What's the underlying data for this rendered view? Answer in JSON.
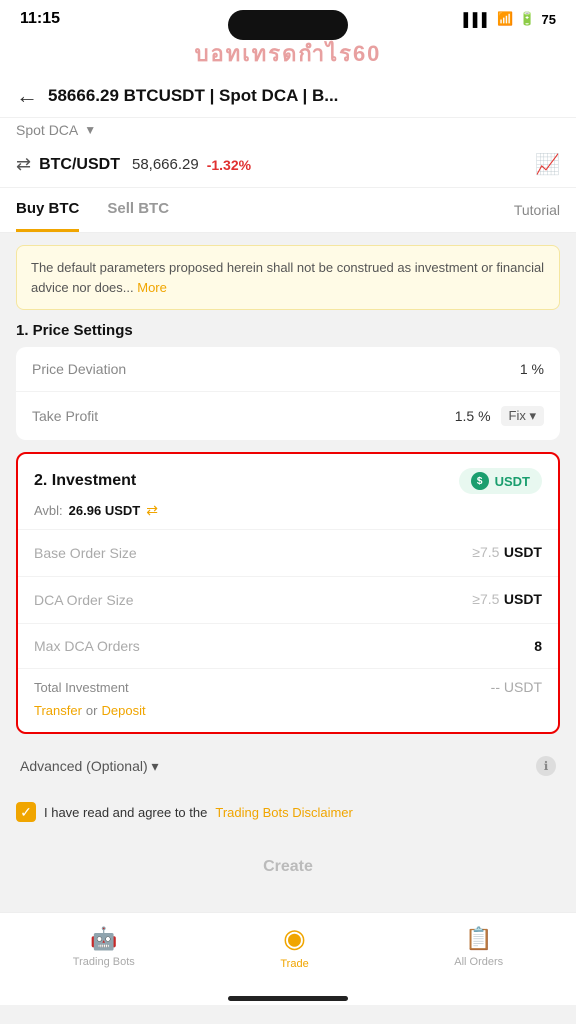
{
  "statusBar": {
    "time": "11:15",
    "batteryLevel": "75"
  },
  "header": {
    "title": "58666.29 BTCUSDT | Spot DCA | B...",
    "backLabel": "←"
  },
  "subHeader": {
    "label": "Spot DCA",
    "dropdownArrow": "▼"
  },
  "pairRow": {
    "swapIcon": "⇄",
    "pairName": "BTC/USDT",
    "price": "58,666.29",
    "change": "-1.32%"
  },
  "tabs": {
    "items": [
      {
        "label": "Buy BTC",
        "active": true
      },
      {
        "label": "Sell BTC",
        "active": false
      }
    ],
    "tutorialLabel": "Tutorial"
  },
  "disclaimer": {
    "text": "The default parameters proposed herein shall not be construed as investment or financial advice nor does...",
    "moreLabel": "More"
  },
  "priceSettings": {
    "sectionTitle": "1. Price Settings",
    "rows": [
      {
        "label": "Price Deviation",
        "value": "1 %"
      },
      {
        "label": "Take Profit",
        "value": "1.5 %",
        "extra": "Fix ▾"
      }
    ]
  },
  "investment": {
    "sectionTitle": "2. Investment",
    "badgeLabel": "USDT",
    "avblLabel": "Avbl:",
    "avblValue": "26.96 USDT",
    "rows": [
      {
        "label": "Base Order Size",
        "minValue": "≥7.5",
        "unit": "USDT"
      },
      {
        "label": "DCA Order Size",
        "minValue": "≥7.5",
        "unit": "USDT"
      },
      {
        "label": "Max DCA Orders",
        "value": "8"
      }
    ],
    "totalLabel": "Total Investment",
    "totalValue": "-- USDT",
    "transferLabel": "Transfer",
    "orLabel": "or",
    "depositLabel": "Deposit"
  },
  "advanced": {
    "label": "Advanced (Optional) ▾"
  },
  "checkbox": {
    "checked": true,
    "text": "I have read and agree to the",
    "linkLabel": "Trading Bots Disclaimer"
  },
  "createButton": {
    "label": "Create"
  },
  "bottomNav": {
    "items": [
      {
        "label": "Trading Bots",
        "icon": "🤖",
        "active": false
      },
      {
        "label": "Trade",
        "icon": "●",
        "active": true
      },
      {
        "label": "All Orders",
        "icon": "📋",
        "active": false
      }
    ]
  }
}
